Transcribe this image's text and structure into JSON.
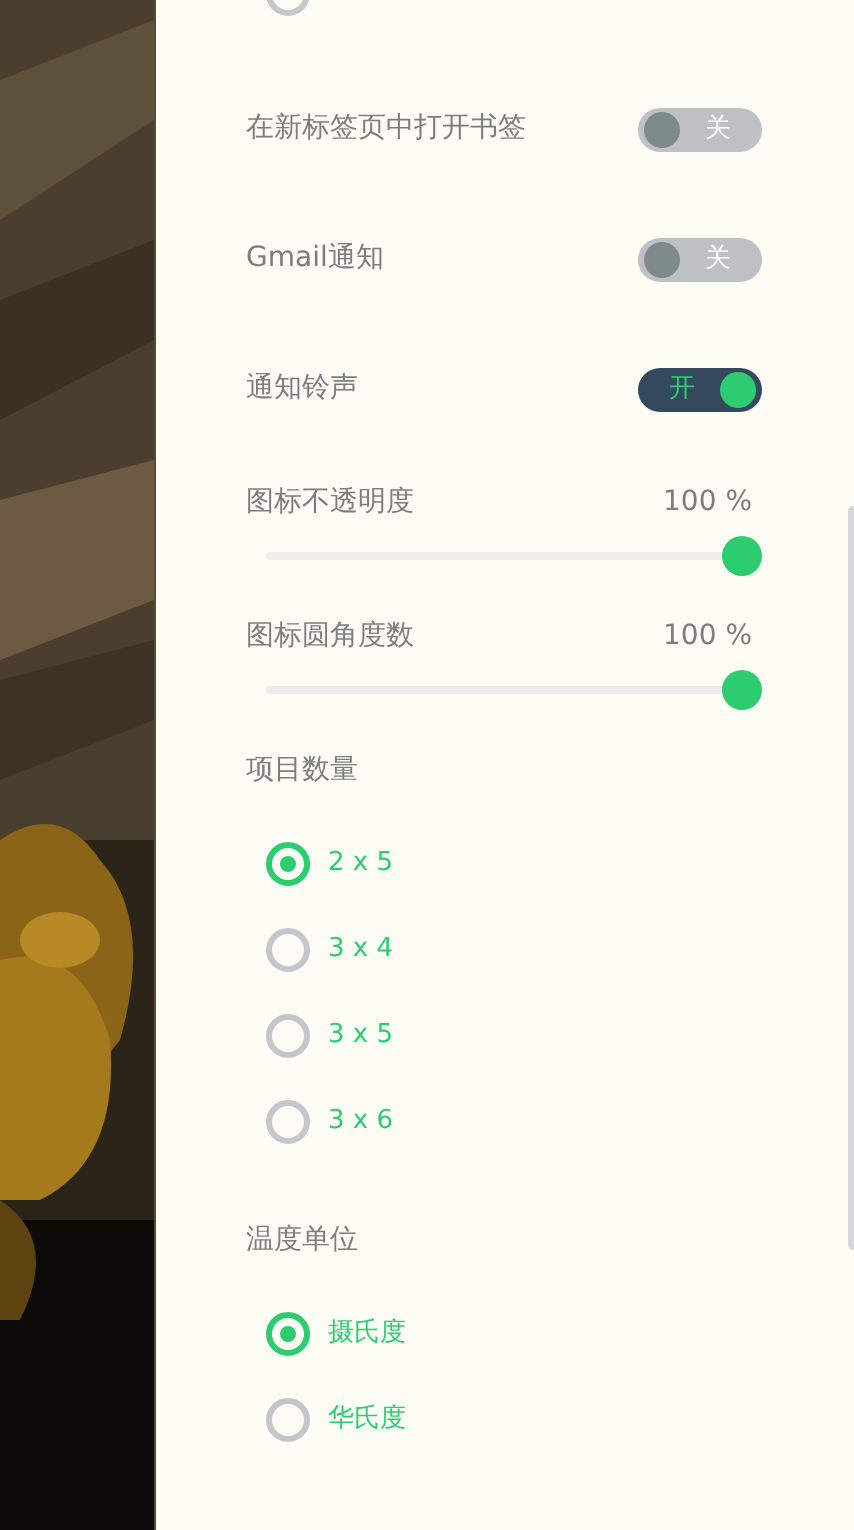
{
  "top_radio": {
    "selected": false
  },
  "toggles": [
    {
      "label": "在新标签页中打开书签",
      "on": false,
      "state_text": "关"
    },
    {
      "label": "Gmail通知",
      "on": false,
      "state_text": "关"
    },
    {
      "label": "通知铃声",
      "on": true,
      "state_text": "开"
    }
  ],
  "sliders": [
    {
      "label": "图标不透明度",
      "reading": "100 %",
      "level": 1
    },
    {
      "label": "图标圆角度数",
      "reading": "100 %",
      "level": 1
    }
  ],
  "radio_groups": [
    {
      "title": "项目数量",
      "options": [
        {
          "label": "2 x 5",
          "selected": true
        },
        {
          "label": "3 x 4",
          "selected": false
        },
        {
          "label": "3 x 5",
          "selected": false
        },
        {
          "label": "3 x 6",
          "selected": false
        }
      ]
    },
    {
      "title": "温度单位",
      "options": [
        {
          "label": "摄氏度",
          "selected": true
        },
        {
          "label": "华氏度",
          "selected": false
        }
      ]
    }
  ]
}
